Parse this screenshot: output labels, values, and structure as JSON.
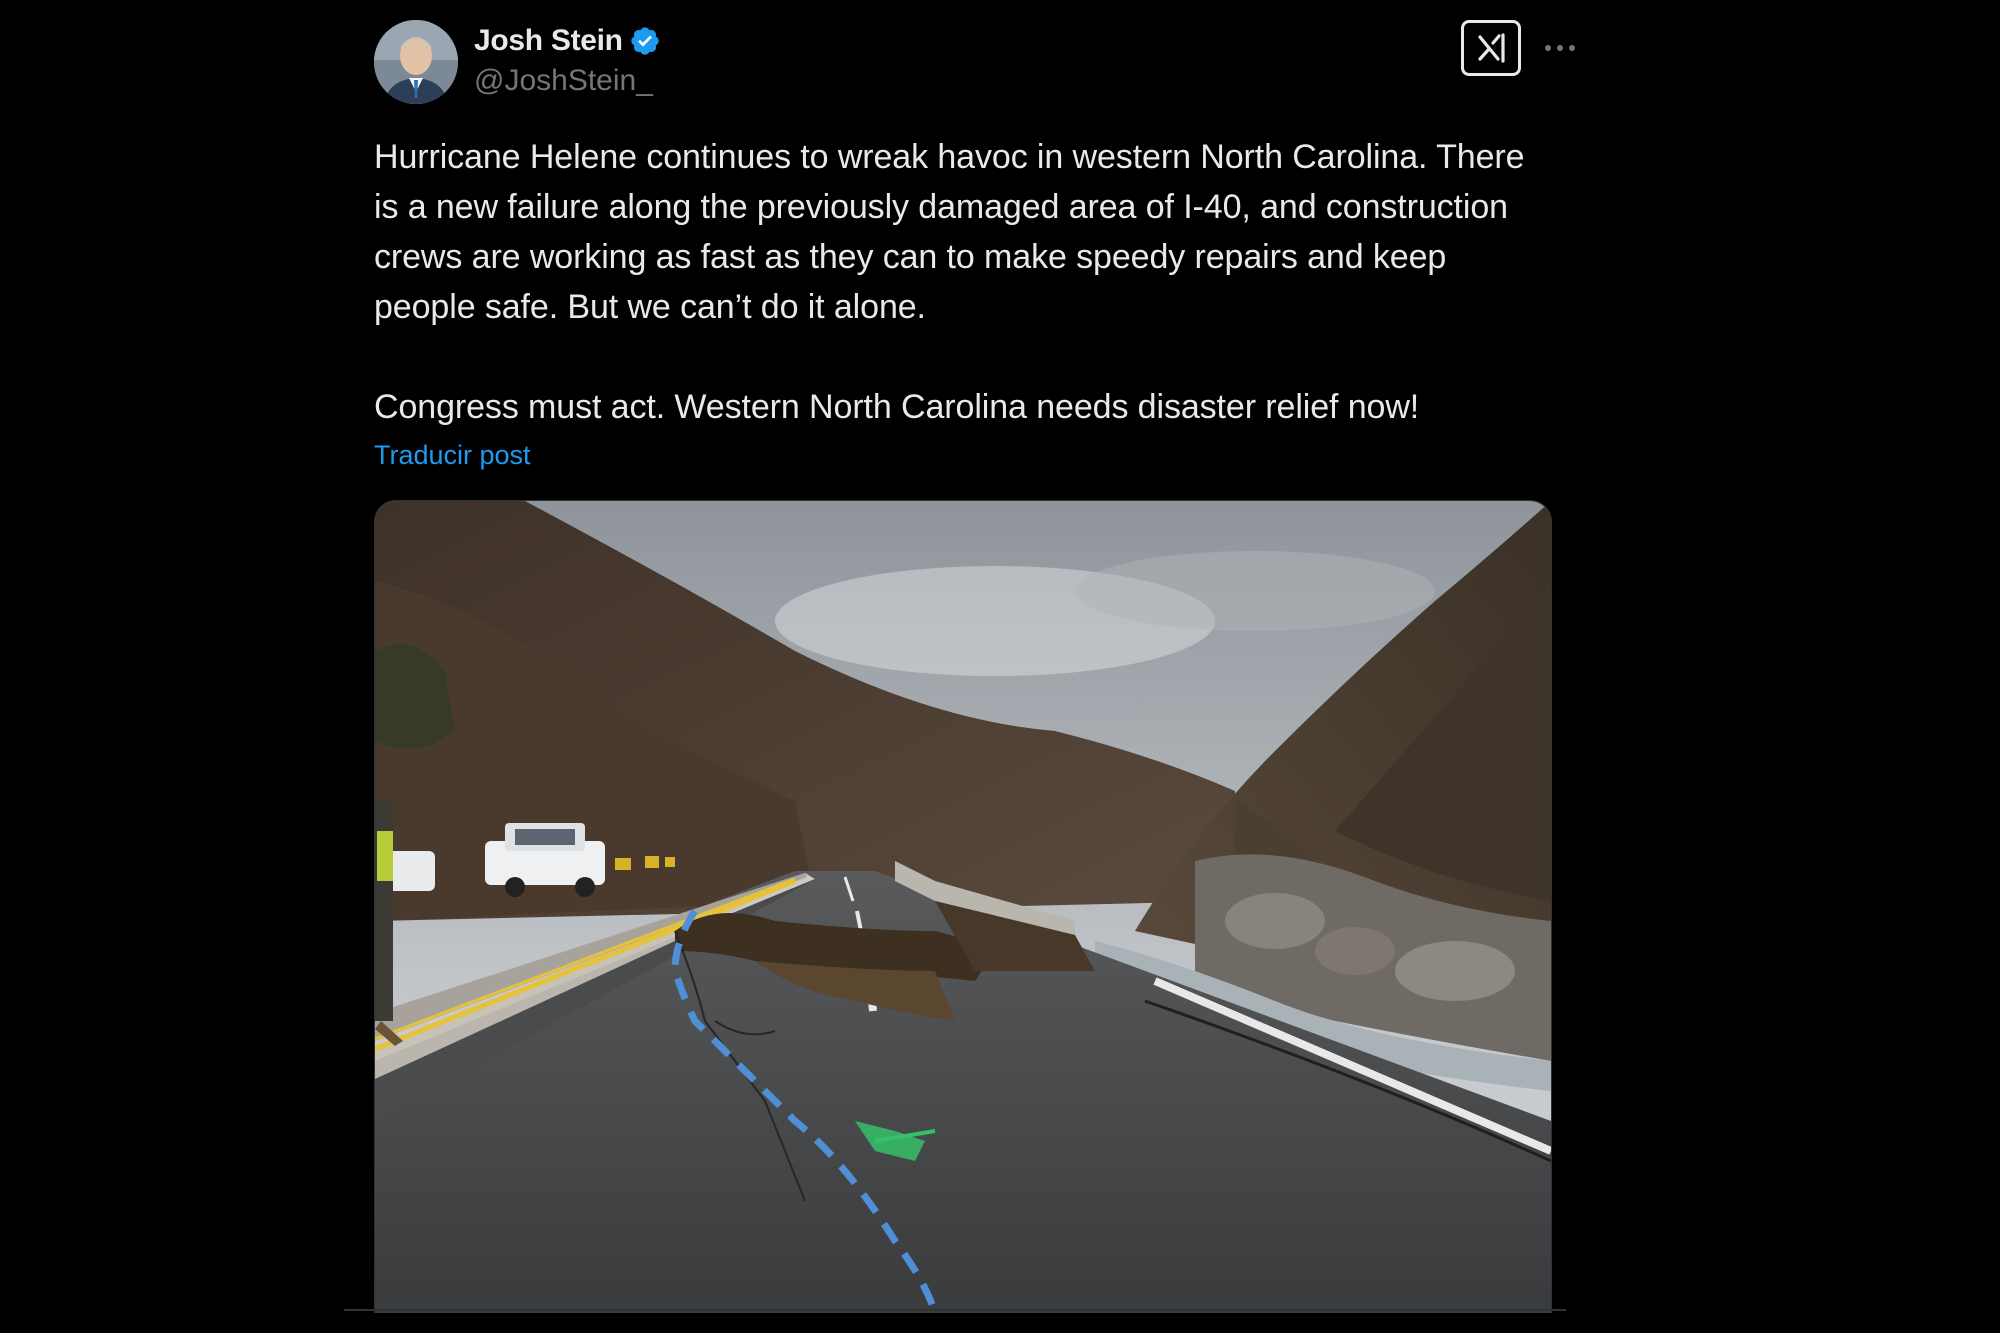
{
  "post": {
    "author": {
      "display_name": "Josh Stein",
      "handle": "@JoshStein_",
      "verified": true,
      "avatar": "avatar"
    },
    "header_icons": {
      "grok": "grok-icon",
      "more": "more-dots-icon"
    },
    "text": "Hurricane Helene continues to wreak havoc in western North Carolina. There is a new failure along the previously damaged area of I-40, and construction crews are working as fast as they can to make speedy repairs and keep people safe. But we can’t do it alone.\n\nCongress must act. Western North Carolina needs disaster relief now!",
    "translate_label": "Traducir post",
    "media": {
      "type": "photo",
      "subject": "collapsed highway lane beside river in a mountain gorge"
    }
  },
  "colors": {
    "background": "#000000",
    "text": "#e7e9ea",
    "secondary_text": "#71767b",
    "link": "#1d9bf0",
    "verified_badge": "#1d9bf0"
  }
}
